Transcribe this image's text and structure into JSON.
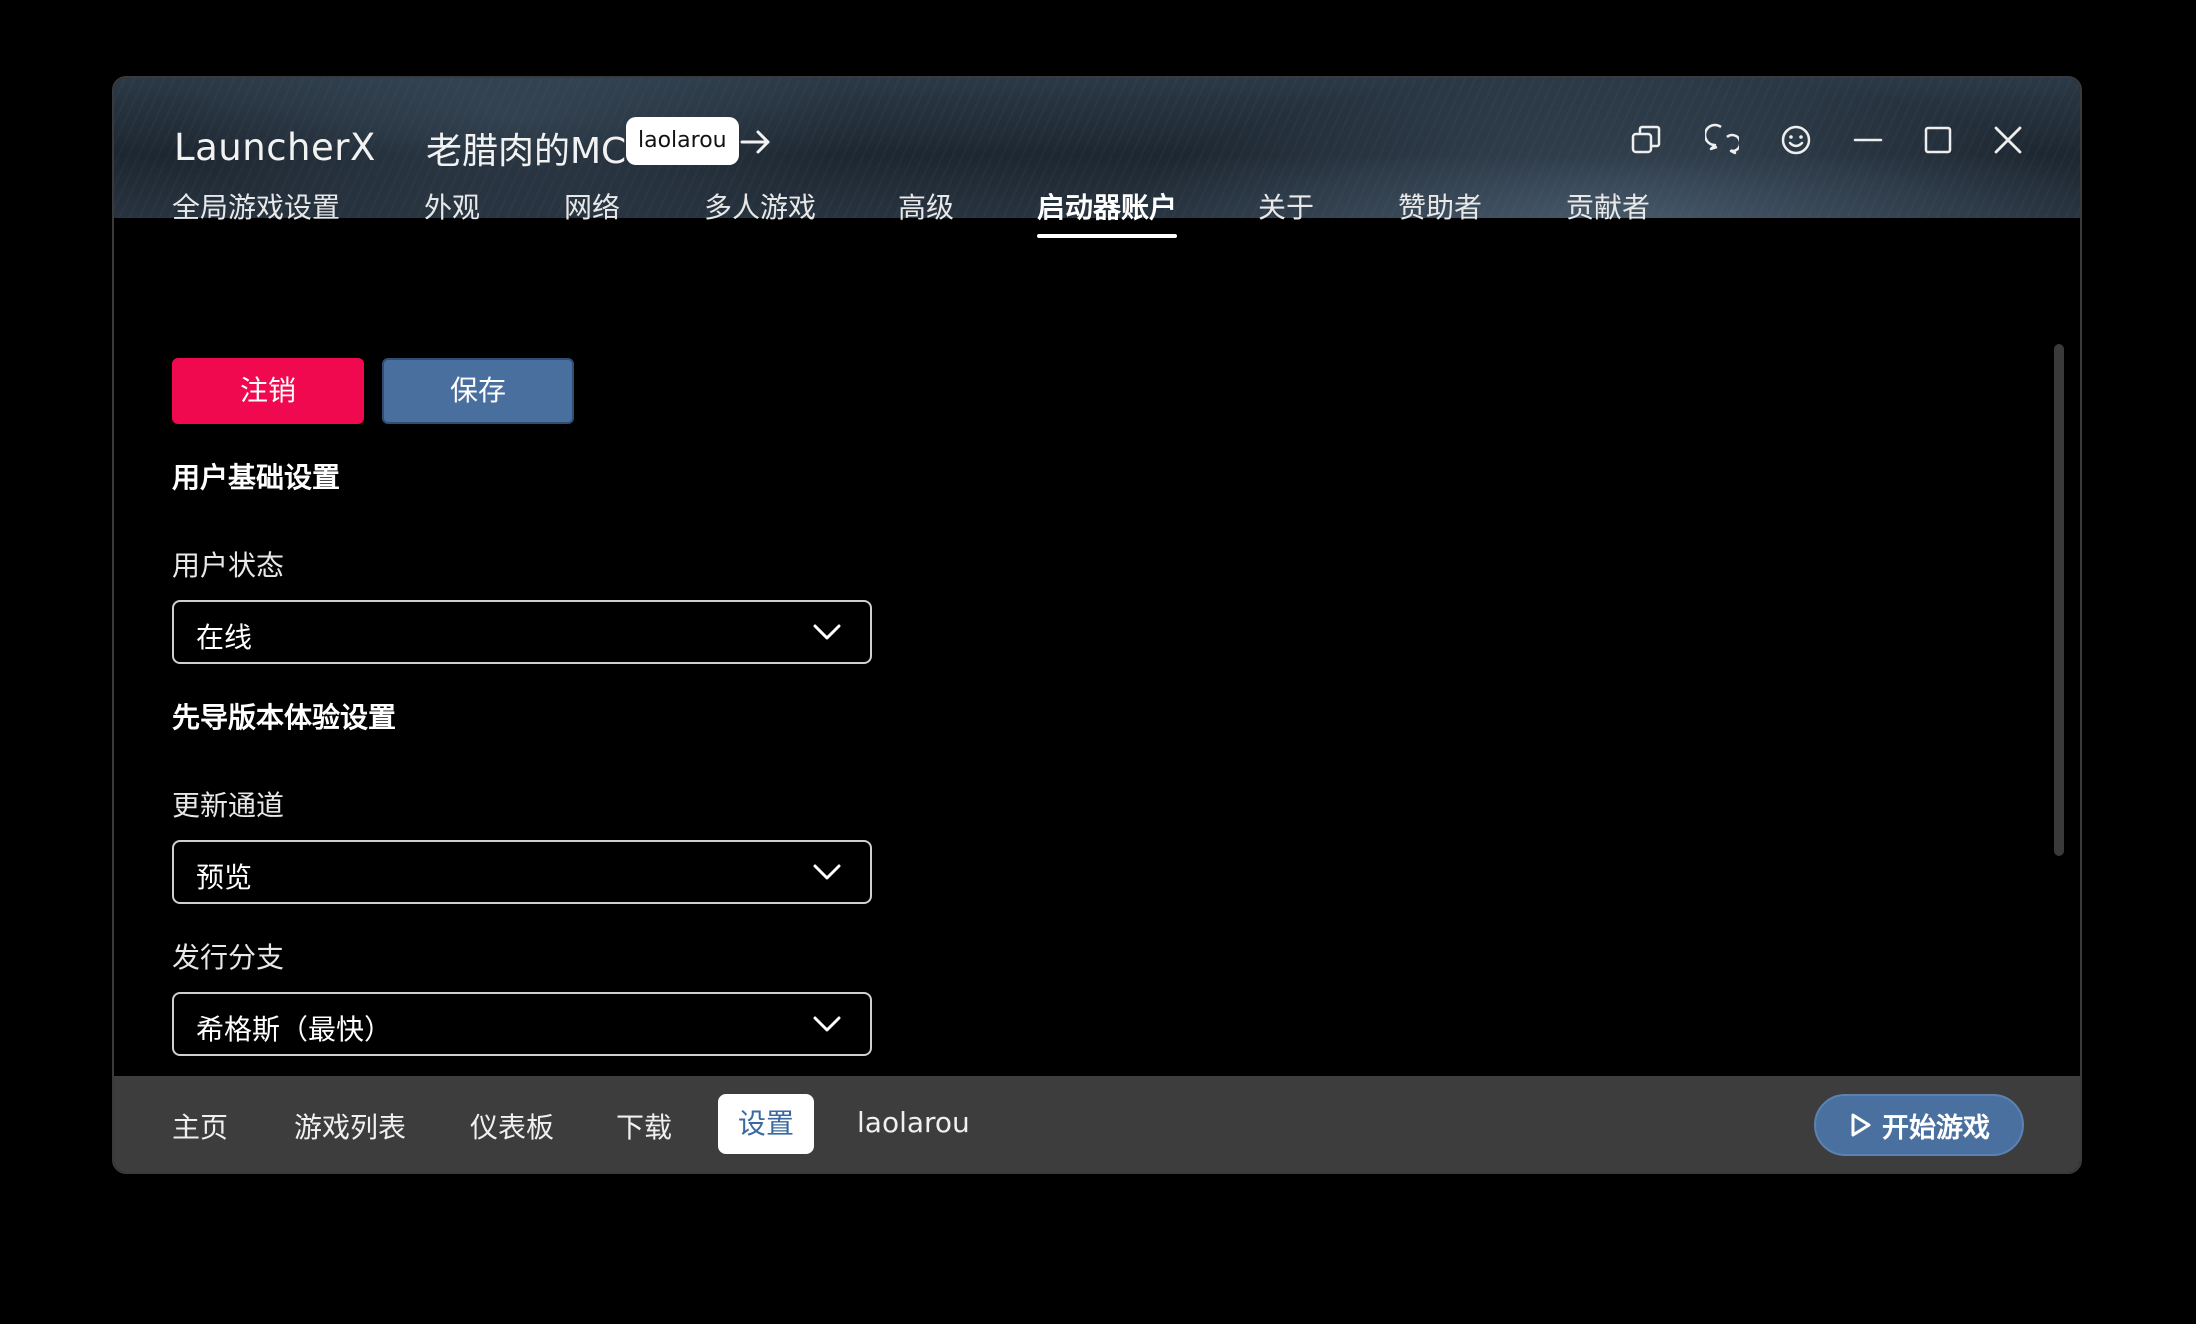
{
  "app": {
    "title": "LauncherX"
  },
  "header": {
    "server_name": "老腊肉的MC",
    "user_chip": "laolarou"
  },
  "window_controls": [
    "copy-icon",
    "chat-icon",
    "smile-icon",
    "minimize-icon",
    "maximize-icon",
    "close-icon"
  ],
  "tabs": [
    {
      "label": "全局游戏设置"
    },
    {
      "label": "外观"
    },
    {
      "label": "网络"
    },
    {
      "label": "多人游戏"
    },
    {
      "label": "高级"
    },
    {
      "label": "启动器账户",
      "active": true
    },
    {
      "label": "关于"
    },
    {
      "label": "赞助者"
    },
    {
      "label": "贡献者"
    }
  ],
  "actions": {
    "logout": "注销",
    "save": "保存"
  },
  "sections": {
    "user_basic": {
      "title": "用户基础设置",
      "status_label": "用户状态",
      "status_value": "在线"
    },
    "preview": {
      "title": "先导版本体验设置",
      "channel_label": "更新通道",
      "channel_value": "预览",
      "branch_label": "发行分支",
      "branch_value": "希格斯（最快）"
    }
  },
  "bottom_nav": {
    "items": [
      {
        "label": "主页"
      },
      {
        "label": "游戏列表"
      },
      {
        "label": "仪表板"
      },
      {
        "label": "下载"
      },
      {
        "label": "设置",
        "active": true
      }
    ],
    "username": "laolarou",
    "play": "开始游戏"
  },
  "colors": {
    "logout": "#f0094f",
    "save": "#486f9e",
    "play": "#4a70a0",
    "bottom_bar": "#3d3d3d",
    "active_nav_text": "#3a6aa0"
  }
}
